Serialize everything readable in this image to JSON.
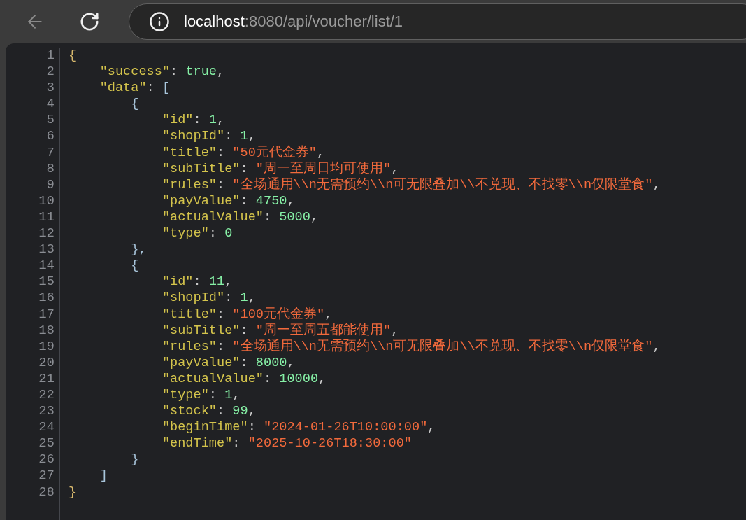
{
  "toolbar": {
    "address": {
      "host": "localhost",
      "path": ":8080/api/voucher/list/1"
    }
  },
  "code": {
    "lines": [
      {
        "number": "1",
        "tokens": [
          {
            "kind": "brace",
            "text": "{"
          }
        ]
      },
      {
        "number": "2",
        "tokens": [
          {
            "kind": "key",
            "text": "    \"success\""
          },
          {
            "kind": "punct",
            "text": ": "
          },
          {
            "kind": "bool",
            "text": "true"
          },
          {
            "kind": "punct",
            "text": ","
          }
        ]
      },
      {
        "number": "3",
        "tokens": [
          {
            "kind": "key",
            "text": "    \"data\""
          },
          {
            "kind": "punct",
            "text": ": "
          },
          {
            "kind": "bracket",
            "text": "["
          }
        ]
      },
      {
        "number": "4",
        "tokens": [
          {
            "kind": "bracket",
            "text": "        {"
          }
        ]
      },
      {
        "number": "5",
        "tokens": [
          {
            "kind": "key",
            "text": "            \"id\""
          },
          {
            "kind": "punct",
            "text": ": "
          },
          {
            "kind": "number",
            "text": "1"
          },
          {
            "kind": "punct",
            "text": ","
          }
        ]
      },
      {
        "number": "6",
        "tokens": [
          {
            "kind": "key",
            "text": "            \"shopId\""
          },
          {
            "kind": "punct",
            "text": ": "
          },
          {
            "kind": "number",
            "text": "1"
          },
          {
            "kind": "punct",
            "text": ","
          }
        ]
      },
      {
        "number": "7",
        "tokens": [
          {
            "kind": "key",
            "text": "            \"title\""
          },
          {
            "kind": "punct",
            "text": ": "
          },
          {
            "kind": "string",
            "text": "\"50元代金券\""
          },
          {
            "kind": "punct",
            "text": ","
          }
        ]
      },
      {
        "number": "8",
        "tokens": [
          {
            "kind": "key",
            "text": "            \"subTitle\""
          },
          {
            "kind": "punct",
            "text": ": "
          },
          {
            "kind": "string",
            "text": "\"周一至周日均可使用\""
          },
          {
            "kind": "punct",
            "text": ","
          }
        ]
      },
      {
        "number": "9",
        "tokens": [
          {
            "kind": "key",
            "text": "            \"rules\""
          },
          {
            "kind": "punct",
            "text": ": "
          },
          {
            "kind": "string",
            "text": "\"全场通用\\\\n无需预约\\\\n可无限叠加\\\\不兑现、不找零\\\\n仅限堂食\""
          },
          {
            "kind": "punct",
            "text": ","
          }
        ]
      },
      {
        "number": "10",
        "tokens": [
          {
            "kind": "key",
            "text": "            \"payValue\""
          },
          {
            "kind": "punct",
            "text": ": "
          },
          {
            "kind": "number",
            "text": "4750"
          },
          {
            "kind": "punct",
            "text": ","
          }
        ]
      },
      {
        "number": "11",
        "tokens": [
          {
            "kind": "key",
            "text": "            \"actualValue\""
          },
          {
            "kind": "punct",
            "text": ": "
          },
          {
            "kind": "number",
            "text": "5000"
          },
          {
            "kind": "punct",
            "text": ","
          }
        ]
      },
      {
        "number": "12",
        "tokens": [
          {
            "kind": "key",
            "text": "            \"type\""
          },
          {
            "kind": "punct",
            "text": ": "
          },
          {
            "kind": "number",
            "text": "0"
          }
        ]
      },
      {
        "number": "13",
        "tokens": [
          {
            "kind": "bracket",
            "text": "        },"
          }
        ]
      },
      {
        "number": "14",
        "tokens": [
          {
            "kind": "bracket",
            "text": "        {"
          }
        ]
      },
      {
        "number": "15",
        "tokens": [
          {
            "kind": "key",
            "text": "            \"id\""
          },
          {
            "kind": "punct",
            "text": ": "
          },
          {
            "kind": "number",
            "text": "11"
          },
          {
            "kind": "punct",
            "text": ","
          }
        ]
      },
      {
        "number": "16",
        "tokens": [
          {
            "kind": "key",
            "text": "            \"shopId\""
          },
          {
            "kind": "punct",
            "text": ": "
          },
          {
            "kind": "number",
            "text": "1"
          },
          {
            "kind": "punct",
            "text": ","
          }
        ]
      },
      {
        "number": "17",
        "tokens": [
          {
            "kind": "key",
            "text": "            \"title\""
          },
          {
            "kind": "punct",
            "text": ": "
          },
          {
            "kind": "string",
            "text": "\"100元代金券\""
          },
          {
            "kind": "punct",
            "text": ","
          }
        ]
      },
      {
        "number": "18",
        "tokens": [
          {
            "kind": "key",
            "text": "            \"subTitle\""
          },
          {
            "kind": "punct",
            "text": ": "
          },
          {
            "kind": "string",
            "text": "\"周一至周五都能使用\""
          },
          {
            "kind": "punct",
            "text": ","
          }
        ]
      },
      {
        "number": "19",
        "tokens": [
          {
            "kind": "key",
            "text": "            \"rules\""
          },
          {
            "kind": "punct",
            "text": ": "
          },
          {
            "kind": "string",
            "text": "\"全场通用\\\\n无需预约\\\\n可无限叠加\\\\不兑现、不找零\\\\n仅限堂食\""
          },
          {
            "kind": "punct",
            "text": ","
          }
        ]
      },
      {
        "number": "20",
        "tokens": [
          {
            "kind": "key",
            "text": "            \"payValue\""
          },
          {
            "kind": "punct",
            "text": ": "
          },
          {
            "kind": "number",
            "text": "8000"
          },
          {
            "kind": "punct",
            "text": ","
          }
        ]
      },
      {
        "number": "21",
        "tokens": [
          {
            "kind": "key",
            "text": "            \"actualValue\""
          },
          {
            "kind": "punct",
            "text": ": "
          },
          {
            "kind": "number",
            "text": "10000"
          },
          {
            "kind": "punct",
            "text": ","
          }
        ]
      },
      {
        "number": "22",
        "tokens": [
          {
            "kind": "key",
            "text": "            \"type\""
          },
          {
            "kind": "punct",
            "text": ": "
          },
          {
            "kind": "number",
            "text": "1"
          },
          {
            "kind": "punct",
            "text": ","
          }
        ]
      },
      {
        "number": "23",
        "tokens": [
          {
            "kind": "key",
            "text": "            \"stock\""
          },
          {
            "kind": "punct",
            "text": ": "
          },
          {
            "kind": "number",
            "text": "99"
          },
          {
            "kind": "punct",
            "text": ","
          }
        ]
      },
      {
        "number": "24",
        "tokens": [
          {
            "kind": "key",
            "text": "            \"beginTime\""
          },
          {
            "kind": "punct",
            "text": ": "
          },
          {
            "kind": "string",
            "text": "\"2024-01-26T10:00:00\""
          },
          {
            "kind": "punct",
            "text": ","
          }
        ]
      },
      {
        "number": "25",
        "tokens": [
          {
            "kind": "key",
            "text": "            \"endTime\""
          },
          {
            "kind": "punct",
            "text": ": "
          },
          {
            "kind": "string",
            "text": "\"2025-10-26T18:30:00\""
          }
        ]
      },
      {
        "number": "26",
        "tokens": [
          {
            "kind": "bracket",
            "text": "        }"
          }
        ]
      },
      {
        "number": "27",
        "tokens": [
          {
            "kind": "bracket",
            "text": "    ]"
          }
        ]
      },
      {
        "number": "28",
        "tokens": [
          {
            "kind": "brace",
            "text": "}"
          }
        ]
      }
    ]
  }
}
